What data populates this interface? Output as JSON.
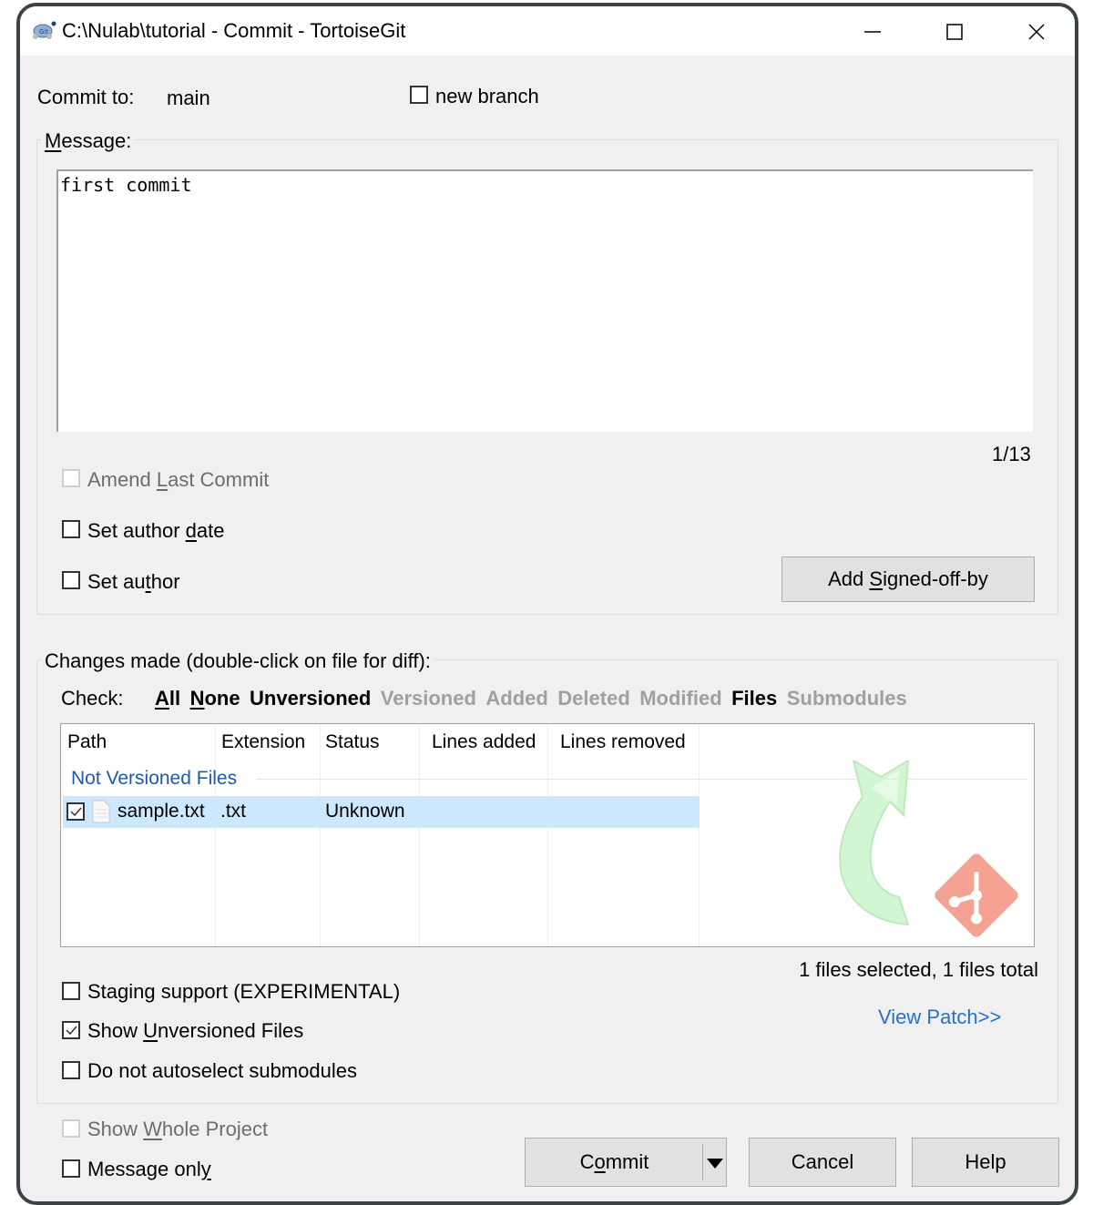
{
  "window": {
    "title": "C:\\Nulab\\tutorial - Commit - TortoiseGit",
    "app_icon": "tortoisegit-icon",
    "controls": {
      "minimize": "minimize-icon",
      "maximize": "maximize-icon",
      "close": "close-icon"
    }
  },
  "commit_to": {
    "label": "Commit to:",
    "branch": "main"
  },
  "new_branch": {
    "label": "new branch",
    "checked": false
  },
  "message": {
    "group_label": "Message:",
    "text": "first commit",
    "counter": "1/13"
  },
  "options": {
    "amend": {
      "label": "Amend Last Commit",
      "checked": false,
      "enabled": false
    },
    "set_author_date": {
      "label": "Set author date",
      "checked": false
    },
    "set_author": {
      "label": "Set author",
      "checked": false
    },
    "add_signed_off_by": "Add Signed-off-by"
  },
  "changes": {
    "group_label": "Changes made (double-click on file for diff):",
    "check_label": "Check:",
    "check_links": [
      {
        "label": "All",
        "enabled": true
      },
      {
        "label": "None",
        "enabled": true
      },
      {
        "label": "Unversioned",
        "enabled": true
      },
      {
        "label": "Versioned",
        "enabled": false
      },
      {
        "label": "Added",
        "enabled": false
      },
      {
        "label": "Deleted",
        "enabled": false
      },
      {
        "label": "Modified",
        "enabled": false
      },
      {
        "label": "Files",
        "enabled": true
      },
      {
        "label": "Submodules",
        "enabled": false
      }
    ],
    "columns": [
      "Path",
      "Extension",
      "Status",
      "Lines added",
      "Lines removed"
    ],
    "groups": [
      {
        "name": "Not Versioned Files",
        "rows": [
          {
            "checked": true,
            "icon": "text-file-icon",
            "path": "sample.txt",
            "extension": ".txt",
            "status": "Unknown",
            "lines_added": "",
            "lines_removed": ""
          }
        ]
      }
    ],
    "summary": "1 files selected, 1 files total",
    "view_patch": "View Patch>>"
  },
  "bottom_options": {
    "staging": {
      "label": "Staging support (EXPERIMENTAL)",
      "checked": false
    },
    "show_unversioned": {
      "label": "Show Unversioned Files",
      "checked": true
    },
    "no_autoselect": {
      "label": "Do not autoselect submodules",
      "checked": false
    },
    "show_whole_project": {
      "label": "Show Whole Project",
      "checked": false,
      "enabled": false
    },
    "message_only": {
      "label": "Message only",
      "checked": false
    }
  },
  "buttons": {
    "commit": "Commit",
    "cancel": "Cancel",
    "help": "Help"
  },
  "colors": {
    "link": "#2b6fc8",
    "group_header": "#1e5aa8",
    "selection": "#cce8ff",
    "git_logo": "#f4a393",
    "arrow": "#d2f5d2"
  }
}
